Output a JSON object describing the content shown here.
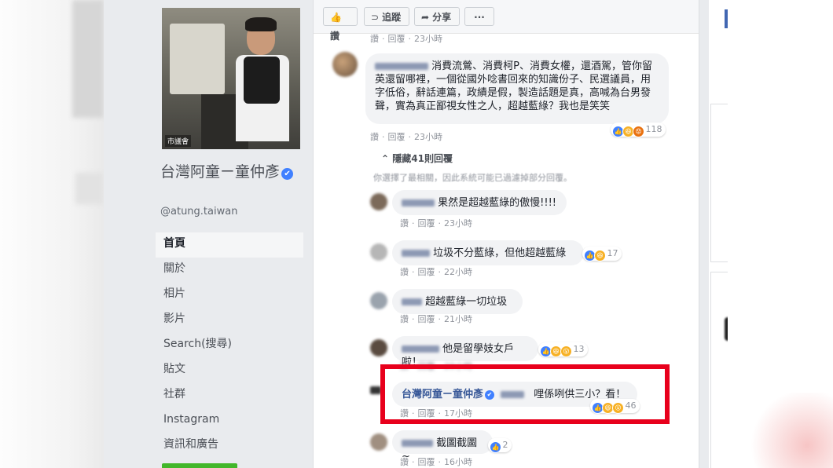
{
  "sidebar": {
    "page_name": "台灣阿童ㄧ童仲彥",
    "handle": "@atung.taiwan",
    "cover_caption": "市議會",
    "nav": [
      "首頁",
      "關於",
      "相片",
      "影片",
      "Search(搜尋)",
      "貼文",
      "社群",
      "Instagram",
      "資訊和廣告"
    ]
  },
  "actions": {
    "like": "讚",
    "follow": "追蹤",
    "share": "分享",
    "more": "···"
  },
  "comment_meta": {
    "like": "讚",
    "reply": "回覆"
  },
  "top_meta_time": "23小時",
  "comments": [
    {
      "text": "消費流鶯、消費柯P、消費女權，還酒駕，管你留英還留哪裡，一個從國外唸書回來的知識份子、民選議員，用字低俗，辭話連篇，政績是假，製造話題是真，高喊為台男發聲，實為真正鄙視女性之人，超越藍綠？我也是笑笑",
      "time": "23小時",
      "count": "118"
    }
  ],
  "hidden_replies": "隱藏41則回覆",
  "filter_notice": "你選擇了最相關，因此系統可能已過濾掉部分回覆。",
  "replies": [
    {
      "text": "果然是超越藍綠的傲慢!!!!",
      "time": "23小時",
      "count": ""
    },
    {
      "text": "垃圾不分藍綠，但他超越藍綠",
      "time": "22小時",
      "count": "17"
    },
    {
      "text": "超越藍綠一切垃圾",
      "time": "21小時",
      "count": ""
    },
    {
      "text": "他是留學妓女戶啦！",
      "time": "20小時",
      "count": "13"
    },
    {
      "author": "台灣阿童ㄧ童仲彥",
      "text": "哩係咧供三小？看！",
      "time": "17小時",
      "count": "46"
    },
    {
      "text": "截圖截圖~",
      "time": "16小時",
      "count": "2"
    }
  ],
  "colors": {
    "highlight": "#e8001c",
    "link": "#385898",
    "verified": "#4080ff"
  }
}
